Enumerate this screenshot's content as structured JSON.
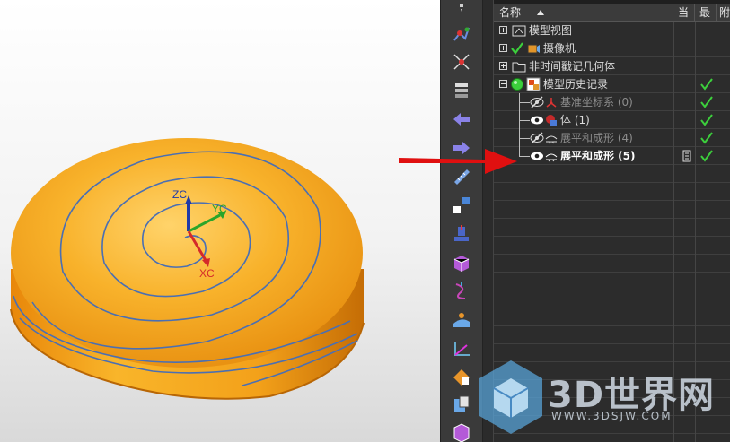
{
  "viewport": {
    "axes": {
      "z": "ZC",
      "y": "YC",
      "x": "XC"
    },
    "colors": {
      "model": "#f5a51a",
      "curve": "#4a6fb3",
      "background": "#eeeeee"
    }
  },
  "toolbar": {
    "icons": [
      "assembly-icon",
      "wcs-icon",
      "layers-icon",
      "back-arrow-icon",
      "forward-arrow-icon",
      "measure-icon",
      "snap-icon",
      "datum-icon",
      "sheet-body-icon",
      "curve-icon",
      "surface-icon",
      "axis-icon",
      "material-icon",
      "part-icon",
      "view-cube-icon"
    ]
  },
  "navigator": {
    "columns": {
      "name": "名称",
      "current": "当",
      "latest": "最",
      "attached": "附"
    },
    "rows": [
      {
        "label": "模型视图",
        "state": "normal"
      },
      {
        "label": "摄像机",
        "state": "normal"
      },
      {
        "label": "非时间戳记几何体",
        "state": "normal"
      },
      {
        "label": "模型历史记录",
        "state": "normal"
      },
      {
        "label": "基准坐标系 (0)",
        "state": "dim"
      },
      {
        "label": "体 (1)",
        "state": "normal"
      },
      {
        "label": "展平和成形 (4)",
        "state": "dim"
      },
      {
        "label": "展平和成形 (5)",
        "state": "bold"
      }
    ]
  },
  "annotation": {
    "arrow_color": "#e01010"
  },
  "watermark": {
    "title": "3D世界网",
    "url": "WWW.3DSJW.COM"
  }
}
